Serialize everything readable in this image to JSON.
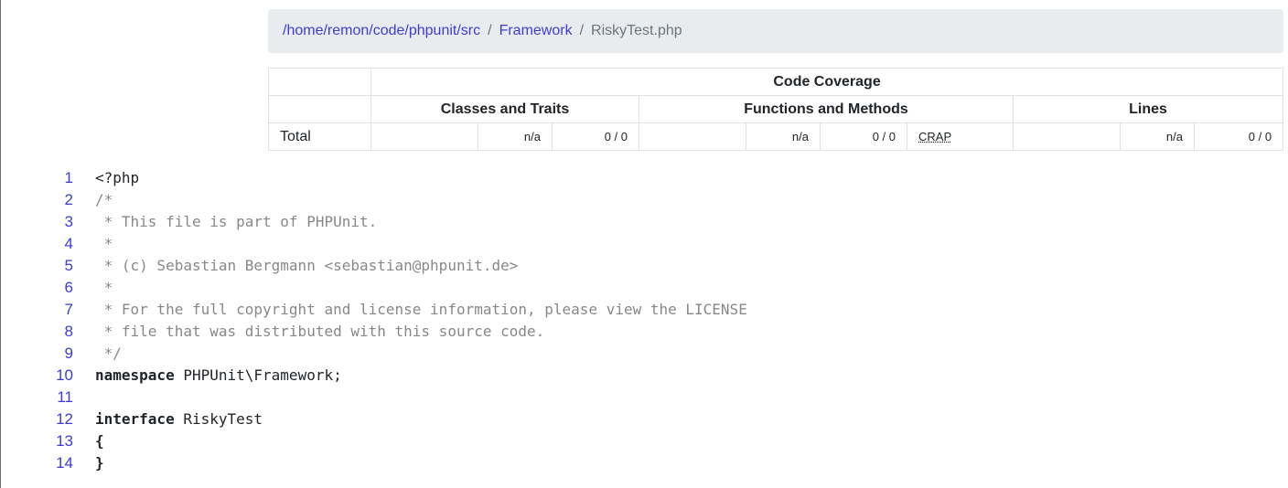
{
  "breadcrumb": {
    "path_link": "/home/remon/code/phpunit/src",
    "sep1": "/",
    "framework_link": "Framework",
    "sep2": "/",
    "current": "RiskyTest.php"
  },
  "coverage": {
    "title": "Code Coverage",
    "headers": {
      "classes": "Classes and Traits",
      "functions": "Functions and Methods",
      "lines": "Lines"
    },
    "total": {
      "label": "Total",
      "classes_pct": "n/a",
      "classes_count": "0 / 0",
      "functions_pct": "n/a",
      "functions_count": "0 / 0",
      "crap": "CRAP",
      "lines_pct": "n/a",
      "lines_count": "0 / 0"
    }
  },
  "code": {
    "lines": [
      {
        "num": "1",
        "text": "<?php",
        "kind": "plain"
      },
      {
        "num": "2",
        "text": "/*",
        "kind": "comment"
      },
      {
        "num": "3",
        "text": " * This file is part of PHPUnit.",
        "kind": "comment"
      },
      {
        "num": "4",
        "text": " *",
        "kind": "comment"
      },
      {
        "num": "5",
        "text": " * (c) Sebastian Bergmann <sebastian@phpunit.de>",
        "kind": "comment"
      },
      {
        "num": "6",
        "text": " *",
        "kind": "comment"
      },
      {
        "num": "7",
        "text": " * For the full copyright and license information, please view the LICENSE",
        "kind": "comment"
      },
      {
        "num": "8",
        "text": " * file that was distributed with this source code.",
        "kind": "comment"
      },
      {
        "num": "9",
        "text": " */",
        "kind": "comment"
      },
      {
        "num": "10",
        "keyword": "namespace",
        "text": " PHPUnit\\Framework;",
        "kind": "keyword"
      },
      {
        "num": "11",
        "text": "",
        "kind": "plain"
      },
      {
        "num": "12",
        "keyword": "interface",
        "text": " RiskyTest",
        "kind": "keyword"
      },
      {
        "num": "13",
        "keyword": "{",
        "text": "",
        "kind": "keyword"
      },
      {
        "num": "14",
        "keyword": "}",
        "text": "",
        "kind": "keyword"
      }
    ]
  }
}
